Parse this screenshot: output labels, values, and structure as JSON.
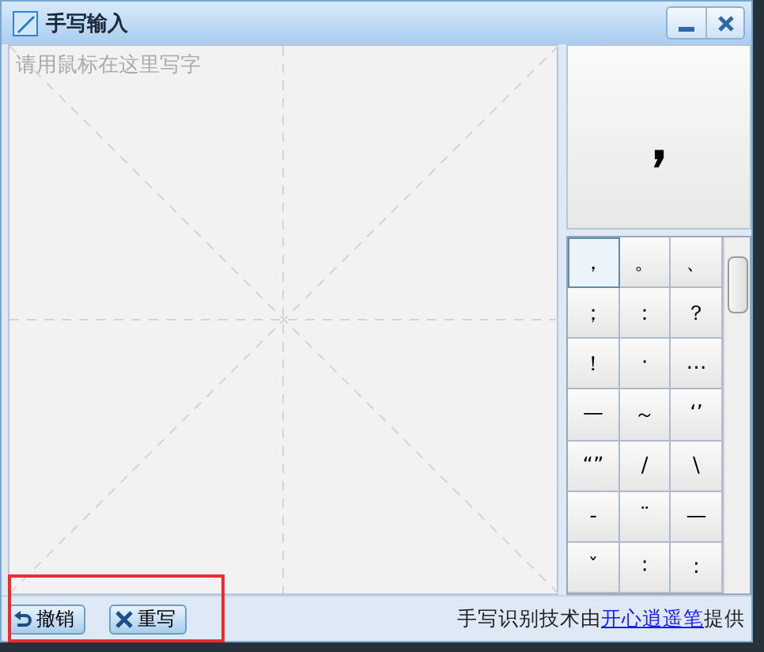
{
  "window": {
    "title": "手写输入"
  },
  "canvas": {
    "placeholder": "请用鼠标在这里写字"
  },
  "preview": {
    "text": "，"
  },
  "symbols": [
    {
      "text": "，",
      "selected": true
    },
    {
      "text": "。",
      "selected": false
    },
    {
      "text": "、",
      "selected": false
    },
    {
      "text": "；",
      "selected": false
    },
    {
      "text": "：",
      "selected": false
    },
    {
      "text": "？",
      "selected": false
    },
    {
      "text": "！",
      "selected": false
    },
    {
      "text": "·",
      "selected": false
    },
    {
      "text": "…",
      "selected": false
    },
    {
      "text": "—",
      "selected": false
    },
    {
      "text": "～",
      "selected": false
    },
    {
      "text": "‘’",
      "selected": false
    },
    {
      "text": "“”",
      "selected": false
    },
    {
      "text": "/",
      "selected": false
    },
    {
      "text": "\\",
      "selected": false
    },
    {
      "text": "-",
      "selected": false
    },
    {
      "text": "¨",
      "selected": false
    },
    {
      "text": "—",
      "selected": false
    },
    {
      "text": "ˇ",
      "selected": false
    },
    {
      "text": "∶",
      "selected": false
    },
    {
      "text": ":",
      "selected": false
    }
  ],
  "buttons": [
    {
      "kind": "undo",
      "label": "撤销"
    },
    {
      "kind": "clear",
      "label": "重写"
    }
  ],
  "footer": {
    "text": "手写识别技术由",
    "link": "开心逍遥笔",
    "suffix": "提供"
  }
}
